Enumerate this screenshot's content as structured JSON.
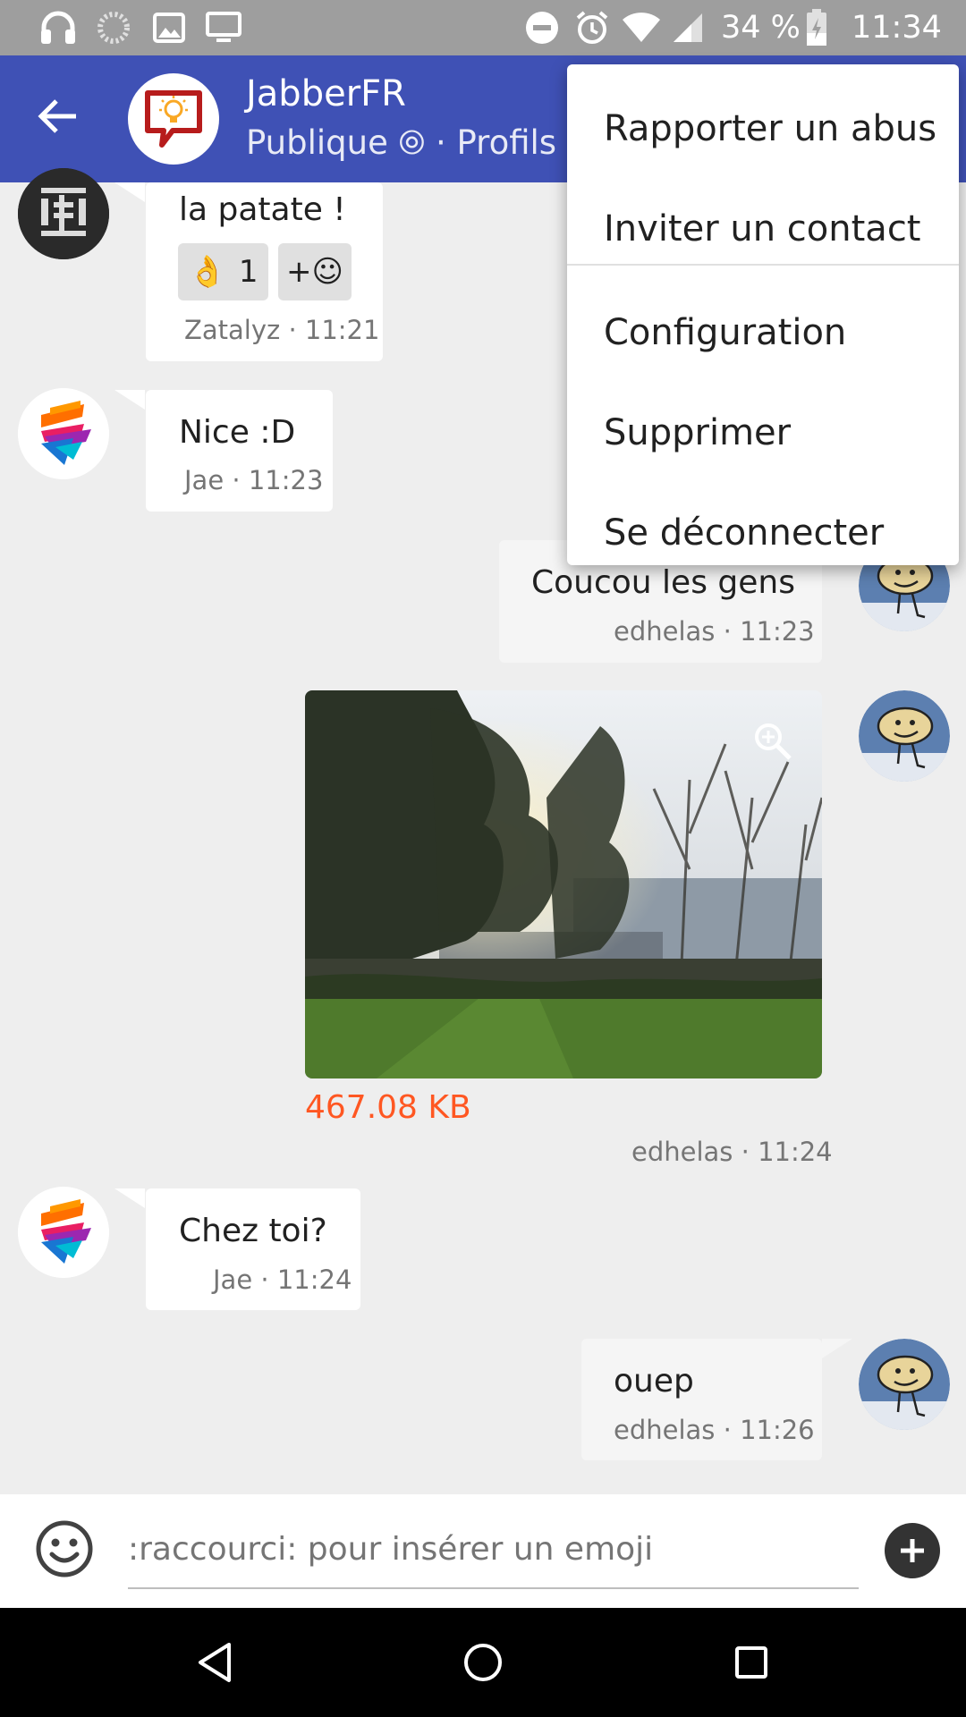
{
  "status_bar": {
    "battery": "34 %",
    "time": "11:34"
  },
  "header": {
    "title": "JabberFR",
    "subtitle": "Publique ⦾ · Profils p"
  },
  "messages": [
    {
      "text": "la patate !",
      "author": "Zatalyz",
      "time": "11:21",
      "meta": "Zatalyz · 11:21",
      "reactions": [
        {
          "emoji": "👌",
          "count": "1"
        }
      ],
      "add_reaction": "+☺"
    },
    {
      "text": "Nice :D",
      "meta": "Jae · 11:23"
    },
    {
      "text": "Coucou les gens",
      "meta": "edhelas · 11:23"
    },
    {
      "file_size": "467.08 KB",
      "meta": "edhelas · 11:24"
    },
    {
      "text": "Chez toi?",
      "meta": "Jae · 11:24"
    },
    {
      "text": "ouep",
      "meta": "edhelas · 11:26"
    }
  ],
  "composer": {
    "placeholder": ":raccourci: pour insérer un emoji"
  },
  "menu": {
    "items": [
      "Rapporter un abus",
      "Inviter un contact",
      "Configuration",
      "Supprimer",
      "Se déconnecter"
    ]
  },
  "colors": {
    "app_bar": "#3f51b5",
    "status_bar": "#9e9e9e",
    "file_size": "#ff5722",
    "background": "#eeeeee"
  },
  "icons": {
    "status_left": [
      "headphones-icon",
      "loading-icon",
      "image-icon",
      "screen-cast-icon"
    ],
    "status_right": [
      "do-not-disturb-icon",
      "alarm-icon",
      "wifi-icon",
      "signal-icon",
      "battery-icon"
    ],
    "header": [
      "back-arrow-icon"
    ],
    "composer": [
      "emoji-icon",
      "add-icon"
    ],
    "nav": [
      "nav-back-icon",
      "nav-home-icon",
      "nav-recents-icon"
    ]
  }
}
